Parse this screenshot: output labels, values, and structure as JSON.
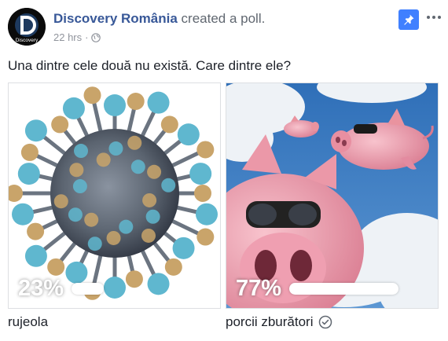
{
  "post": {
    "author": "Discovery România",
    "action": "created a poll.",
    "time": "22 hrs",
    "separator": "·",
    "privacy_icon": "globe-icon",
    "avatar_text": "Discovery",
    "question": "Una dintre cele două nu există. Care dintre ele?"
  },
  "toolbar": {
    "pin_icon": "pin-icon",
    "more_icon": "more-options-icon"
  },
  "poll": {
    "options": [
      {
        "label": "rujeola",
        "percent_text": "23%",
        "share": 0.23,
        "image": "measles-virus-illustration",
        "selected": false
      },
      {
        "label": "porcii zburători",
        "percent_text": "77%",
        "share": 0.77,
        "image": "flying-pigs-illustration",
        "selected": true,
        "selected_icon": "check-circle-icon"
      }
    ]
  },
  "colors": {
    "link": "#385898",
    "muted": "#90949c",
    "pin_bg": "#4080ff",
    "sky": "#3f7cc2",
    "pig": "#f2a2b1",
    "virus_core": "#5b6470",
    "virus_spike_blue": "#5fb7cf",
    "virus_spike_tan": "#c9a46a"
  }
}
